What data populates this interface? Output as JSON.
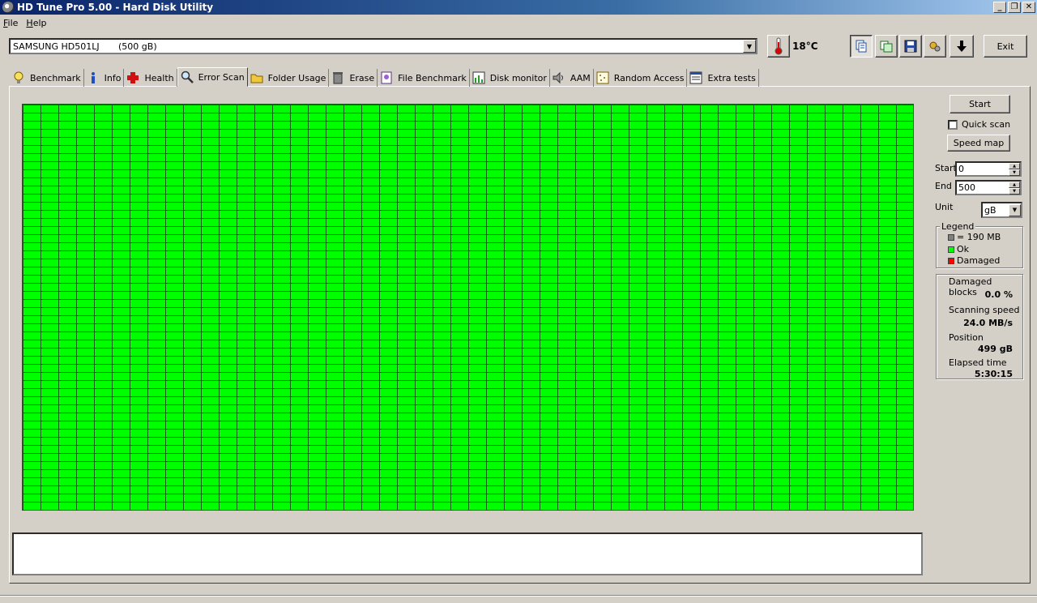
{
  "window": {
    "title": "HD Tune Pro 5.00 - Hard Disk Utility"
  },
  "menu": {
    "file": "File",
    "help": "Help"
  },
  "toolbar": {
    "drive_name": "SAMSUNG HD501LJ",
    "drive_size": "(500 gB)",
    "temperature": "18°C",
    "exit_label": "Exit",
    "icons": [
      "copy-text-icon",
      "copy-screen-icon",
      "save-icon",
      "options-icon",
      "download-icon"
    ]
  },
  "tabs": [
    {
      "label": "Benchmark",
      "icon": "lightbulb-icon"
    },
    {
      "label": "Info",
      "icon": "info-icon"
    },
    {
      "label": "Health",
      "icon": "red-cross-icon"
    },
    {
      "label": "Error Scan",
      "icon": "magnifier-icon",
      "active": true
    },
    {
      "label": "Folder Usage",
      "icon": "folder-icon"
    },
    {
      "label": "Erase",
      "icon": "trash-icon"
    },
    {
      "label": "File Benchmark",
      "icon": "file-benchmark-icon"
    },
    {
      "label": "Disk monitor",
      "icon": "monitor-chart-icon"
    },
    {
      "label": "AAM",
      "icon": "speaker-icon"
    },
    {
      "label": "Random Access",
      "icon": "random-access-icon"
    },
    {
      "label": "Extra tests",
      "icon": "extra-tests-icon"
    }
  ],
  "scan": {
    "start_button": "Start",
    "quick_scan_label": "Quick scan",
    "quick_scan_checked": false,
    "speed_map_button": "Speed map",
    "start_label": "Start",
    "start_value": "0",
    "end_label": "End",
    "end_value": "500",
    "unit_label": "Unit",
    "unit_value": "gB"
  },
  "legend": {
    "title": "Legend",
    "items": [
      {
        "label": "= 190 MB",
        "color": "#808080"
      },
      {
        "label": "Ok",
        "color": "#00ff00"
      },
      {
        "label": "Damaged",
        "color": "#ff0000"
      }
    ]
  },
  "stats": {
    "damaged_label": "Damaged blocks",
    "damaged_value": "0.0 %",
    "speed_label": "Scanning speed",
    "speed_value": "24.0 MB/s",
    "position_label": "Position",
    "position_value": "499 gB",
    "elapsed_label": "Elapsed time",
    "elapsed_value": "5:30:15"
  },
  "colors": {
    "ok_block": "#00ff00",
    "grid_line": "#1b5e1b"
  }
}
